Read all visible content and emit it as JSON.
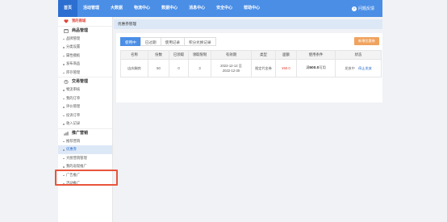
{
  "topnav": {
    "items": [
      "首页",
      "活动管理",
      "大数据",
      "物流中心",
      "数据中心",
      "消息中心",
      "安全中心",
      "帮助中心"
    ],
    "active_index": 0,
    "feedback_label": "问题反馈",
    "feedback_icon": "help-icon",
    "bg_color": "#4a8ee6"
  },
  "sidebar": {
    "shop": {
      "label": "我的商城",
      "icon": "heart-icon"
    },
    "goods": {
      "label": "商品管理",
      "icon": "store-icon",
      "items": [
        "品牌管理",
        "分类设置",
        "属性模板",
        "发布商品",
        "库存管理"
      ]
    },
    "trade": {
      "label": "交易管理",
      "icon": "trade-icon",
      "items": [
        "物流审核",
        "我的订单",
        "评价管理",
        "投诉订单",
        "收入记录"
      ]
    },
    "promo": {
      "label": "推广营销",
      "icon": "chart-icon",
      "items": [
        "推荐营销",
        "优惠券",
        "大厨营销管理",
        "我的返现推广",
        "广告推广",
        "活动推广"
      ],
      "selected_index": 1
    }
  },
  "breadcrumb": "优惠券管理",
  "tabs": [
    "使用中",
    "已过期",
    "使用记录",
    "积分兑换记录"
  ],
  "active_tab": 0,
  "new_button": "新增优惠券",
  "table": {
    "headers": [
      "名称",
      "份数",
      "已领取",
      "领取限制",
      "有效期",
      "类型",
      "面额",
      "使用条件",
      "状态"
    ],
    "rows": [
      {
        "name": "店庆酬宾",
        "count": "50",
        "received": "0",
        "limit": "3",
        "valid_from": "2022-12-12 至",
        "valid_to": "2022-12-30",
        "type": "限定代金券",
        "amount": "¥50.0",
        "cond_prefix": "满",
        "cond_amount": "500.0",
        "cond_suffix": "可用",
        "status": "发放中",
        "action": "停止发放"
      }
    ]
  }
}
